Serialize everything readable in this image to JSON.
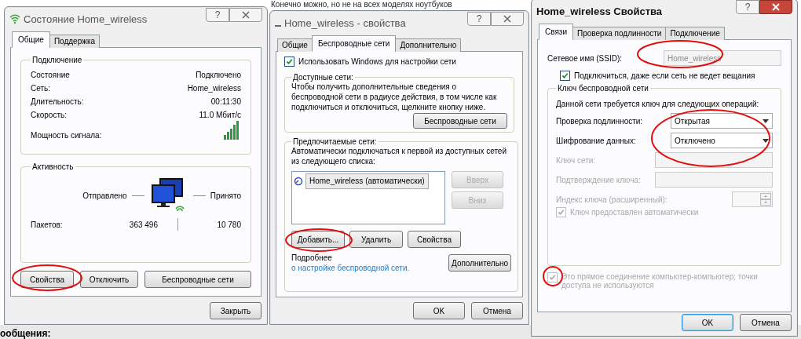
{
  "background": {
    "top_text": "Конечно можно, но не на всех моделях ноутбуков",
    "bottom_text": "ообщения:"
  },
  "status_dialog": {
    "title": "Состояние Home_wireless",
    "help_glyph": "?",
    "tabs": [
      {
        "label": "Общие",
        "selected": true
      },
      {
        "label": "Поддержка",
        "selected": false
      }
    ],
    "connection": {
      "legend": "Подключение",
      "rows": [
        {
          "label": "Состояние",
          "value": "Подключено"
        },
        {
          "label": "Сеть:",
          "value": "Home_wireless"
        },
        {
          "label": "Длительность:",
          "value": "00:11:30"
        },
        {
          "label": "Скорость:",
          "value": "11.0 Мбит/с"
        }
      ],
      "signal_label": "Мощность сигнала:"
    },
    "activity": {
      "legend": "Активность",
      "sent_label": "Отправлено",
      "received_label": "Принято",
      "packets_label": "Пакетов:",
      "sent": "363 496",
      "received": "10 780"
    },
    "buttons": [
      "Свойства",
      "Отключить",
      "Беспроводные сети"
    ],
    "close_button": "Закрыть"
  },
  "wireless_dialog": {
    "title": "Home_wireless - свойства",
    "help_glyph": "?",
    "tabs": [
      {
        "label": "Общие",
        "selected": false
      },
      {
        "label": "Беспроводные сети",
        "selected": true
      },
      {
        "label": "Дополнительно",
        "selected": false
      }
    ],
    "use_windows": {
      "label": "Использовать Windows для настройки сети",
      "checked": true
    },
    "available": {
      "legend": "Доступные сети:",
      "text": "Чтобы получить дополнительные сведения о беспроводной сети в радиусе действия, в том числе как подключиться и отключиться, щелкните кнопку ниже.",
      "button": "Беспроводные сети"
    },
    "preferred": {
      "legend": "Предпочитаемые сети:",
      "text": "Автоматически подключаться к первой из доступных сетей из следующего списка:",
      "networks": [
        {
          "name": "Home_wireless (автоматически)",
          "selected": true
        }
      ],
      "move_buttons": [
        {
          "label": "Вверх",
          "disabled": true
        },
        {
          "label": "Вниз",
          "disabled": true
        }
      ],
      "buttons": [
        "Добавить...",
        "Удалить",
        "Свойства"
      ],
      "more_text": "Подробнее ",
      "more_link": "о настройке беспроводной сети.",
      "advanced_button": "Дополнительно"
    },
    "ok": "OK",
    "cancel": "Отмена"
  },
  "props_dialog": {
    "title": "Home_wireless Свойства",
    "help_glyph": "?",
    "tabs": [
      {
        "label": "Связи",
        "selected": true
      },
      {
        "label": "Проверка подлинности",
        "selected": false
      },
      {
        "label": "Подключение",
        "selected": false
      }
    ],
    "ssid": {
      "label": "Сетевое имя (SSID):",
      "value": "Home_wireless",
      "disabled": true
    },
    "hidden_broadcast": {
      "label": "Подключиться, даже если сеть не ведет вещания",
      "checked": true
    },
    "key_group": {
      "legend": "Ключ беспроводной сети",
      "text": "Данной сети требуется ключ для следующих операций:",
      "selects": [
        {
          "label": "Проверка подлинности:",
          "value": "Открытая"
        },
        {
          "label": "Шифрование данных:",
          "value": "Отключено"
        }
      ],
      "key_fields": [
        {
          "label": "Ключ сети:",
          "disabled": true
        },
        {
          "label": "Подтверждение ключа:",
          "disabled": true
        }
      ],
      "index": {
        "label": "Индекс ключа (расширенный):",
        "disabled": true
      },
      "auto_key": {
        "label": "Ключ предоставлен автоматически",
        "checked": true,
        "disabled": true
      }
    },
    "adhoc": {
      "label": "Это прямое соединение компьютер-компьютер; точки доступа не используются",
      "checked": true,
      "disabled": true
    },
    "ok": "OK",
    "cancel": "Отмена"
  }
}
